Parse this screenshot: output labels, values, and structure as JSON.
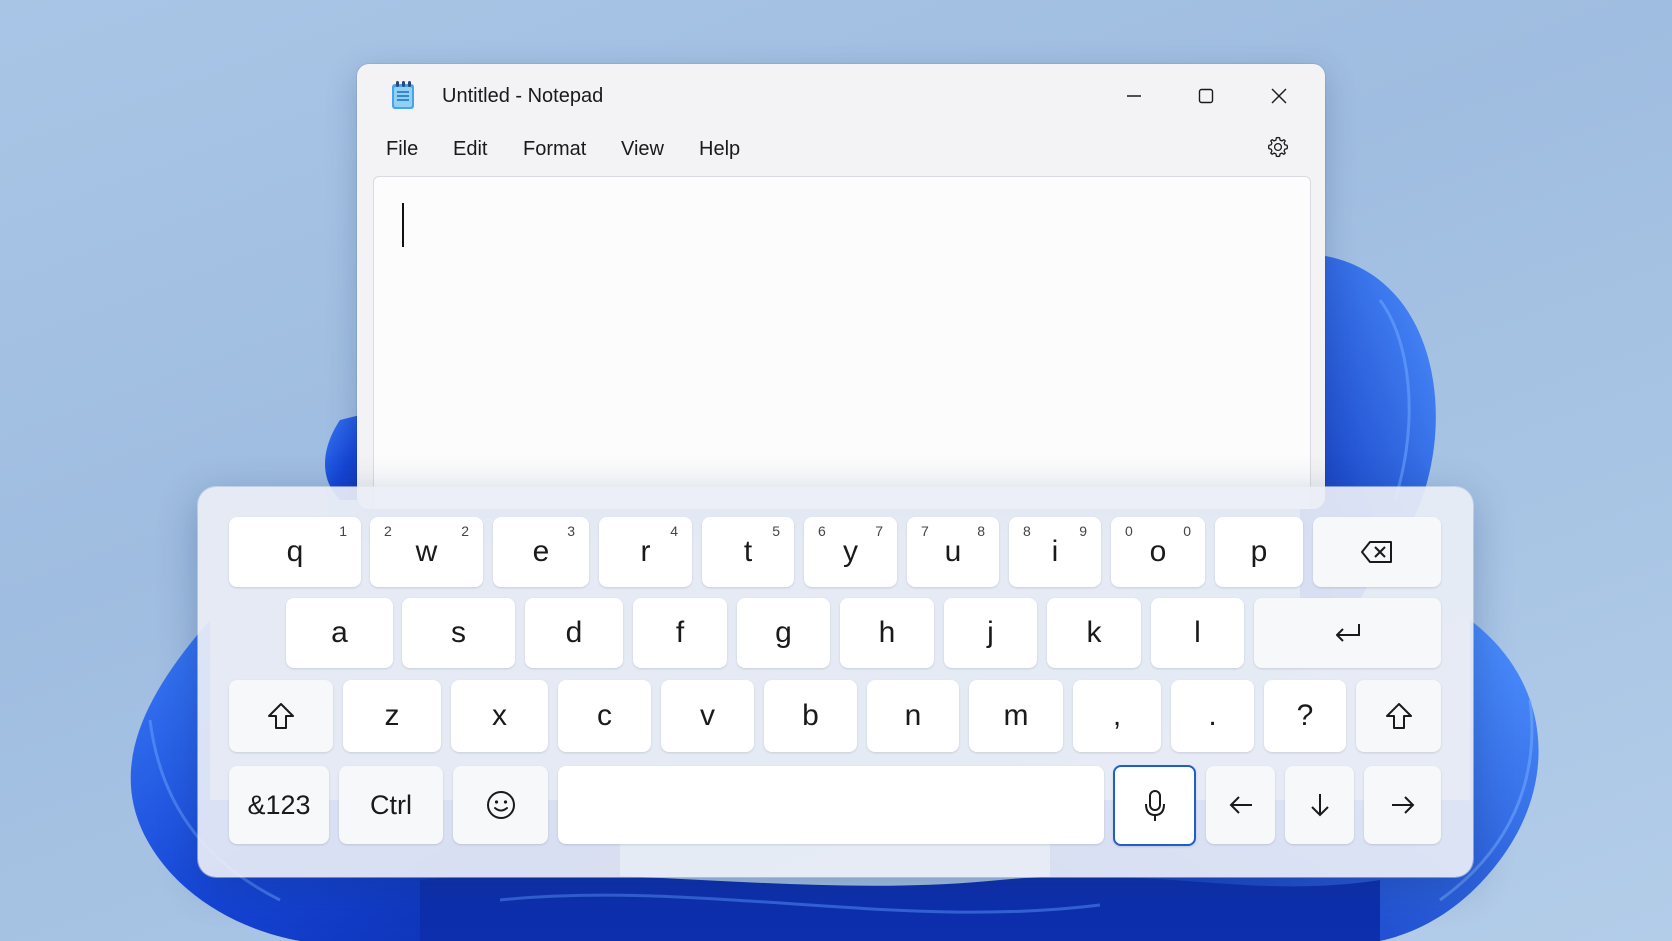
{
  "window": {
    "title": "Untitled - Notepad",
    "menu": [
      "File",
      "Edit",
      "Format",
      "View",
      "Help"
    ]
  },
  "editor": {
    "text": ""
  },
  "keyboard": {
    "row1": [
      {
        "label": "q",
        "hint_right": "1"
      },
      {
        "label": "w",
        "hint_left": "2",
        "hint_right": "2"
      },
      {
        "label": "e",
        "hint_right": "3"
      },
      {
        "label": "r",
        "hint_right": "4"
      },
      {
        "label": "t",
        "hint_right": "5"
      },
      {
        "label": "y",
        "hint_left": "6",
        "hint_right": "7"
      },
      {
        "label": "u",
        "hint_left": "7",
        "hint_right": "8"
      },
      {
        "label": "i",
        "hint_left": "8",
        "hint_right": "9"
      },
      {
        "label": "o",
        "hint_left": "0",
        "hint_right": "0"
      },
      {
        "label": "p"
      }
    ],
    "row2": [
      "a",
      "s",
      "d",
      "f",
      "g",
      "h",
      "j",
      "k",
      "l"
    ],
    "row3": [
      "z",
      "x",
      "c",
      "v",
      "b",
      "n",
      "m",
      ",",
      ".",
      "?"
    ],
    "symbols_label": "&123",
    "ctrl_label": "Ctrl",
    "icons": {
      "backspace": "backspace-icon",
      "enter": "enter-icon",
      "shift": "shift-icon",
      "emoji": "emoji-icon",
      "mic": "microphone-icon",
      "left": "arrow-left-icon",
      "down": "arrow-down-icon",
      "right": "arrow-right-icon"
    }
  },
  "colors": {
    "accent": "#1f5fc7",
    "wallpaper_bloom": "#1a4fe0",
    "background": "#a9c5e6"
  }
}
